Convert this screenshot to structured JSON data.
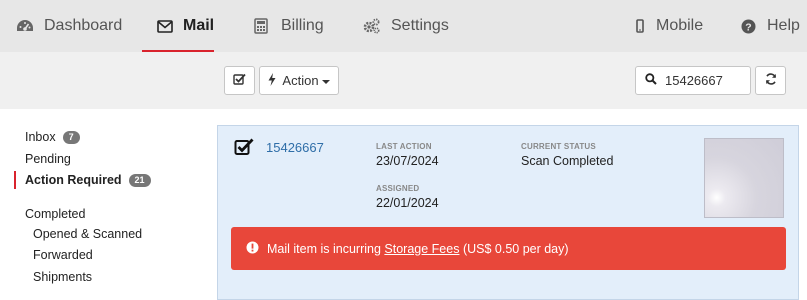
{
  "nav": {
    "dashboard": "Dashboard",
    "mail": "Mail",
    "billing": "Billing",
    "settings": "Settings",
    "mobile": "Mobile",
    "help": "Help"
  },
  "toolbar": {
    "action_label": "Action",
    "search_value": "15426667"
  },
  "sidebar": {
    "inbox": {
      "label": "Inbox",
      "count": "7"
    },
    "pending": {
      "label": "Pending"
    },
    "action_required": {
      "label": "Action Required",
      "count": "21"
    },
    "completed": {
      "label": "Completed"
    },
    "opened_scanned": {
      "label": "Opened & Scanned"
    },
    "forwarded": {
      "label": "Forwarded"
    },
    "shipments": {
      "label": "Shipments"
    }
  },
  "item": {
    "id": "15426667",
    "last_action_label": "LAST ACTION",
    "last_action": "23/07/2024",
    "assigned_label": "ASSIGNED",
    "assigned": "22/01/2024",
    "status_label": "CURRENT STATUS",
    "status": "Scan Completed",
    "alert_prefix": "Mail item is incurring",
    "alert_link": "Storage Fees",
    "alert_suffix": "(US$ 0.50 per day)"
  },
  "colors": {
    "accent_red": "#d9232d",
    "alert_red": "#e8473a",
    "link_blue": "#2f6ea8",
    "card_bg": "#e3eefa"
  },
  "icons": [
    "dashboard-icon",
    "envelope-icon",
    "calculator-icon",
    "cogs-icon",
    "mobile-icon",
    "question-circle-icon",
    "checkbox-icon",
    "bolt-icon",
    "search-icon",
    "refresh-icon",
    "exclamation-circle-icon"
  ]
}
